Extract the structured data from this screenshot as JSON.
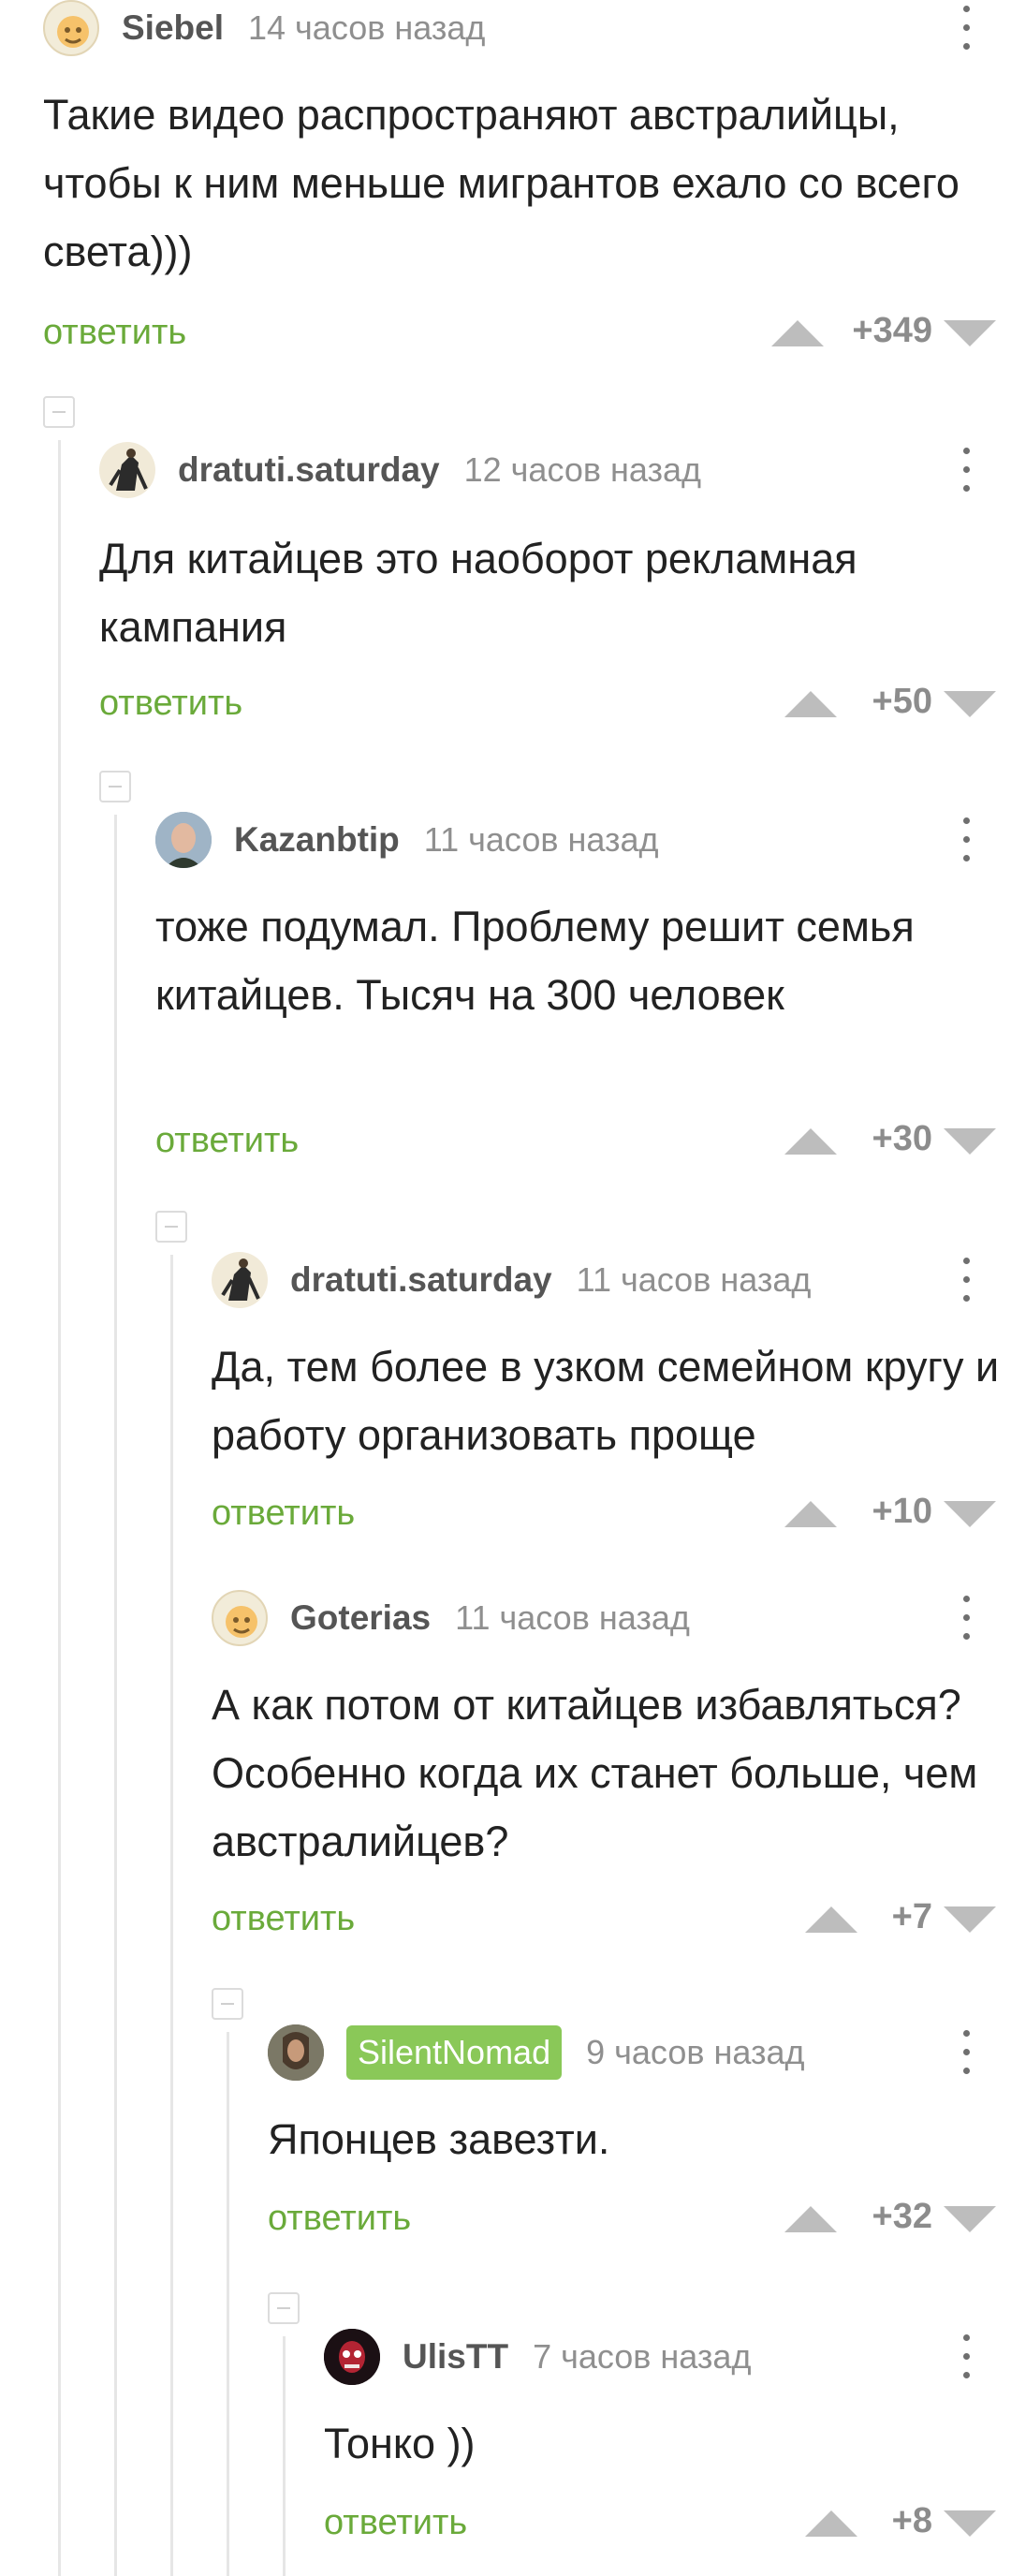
{
  "comments": [
    {
      "username": "Siebel",
      "time": "14 часов назад",
      "text": "Такие видео распространяют австралийцы, чтобы к ним меньше мигрантов ехало со всего света)))",
      "reply": "ответить",
      "rating": "+349"
    },
    {
      "username": "dratuti.saturday",
      "time": "12 часов назад",
      "text": "Для китайцев это наоборот рекламная кампания",
      "reply": "ответить",
      "rating": "+50"
    },
    {
      "username": "Kazanbtip",
      "time": "11 часов назад",
      "text": "тоже подумал. Проблему решит семья китайцев. Тысяч на 300 человек",
      "reply": "ответить",
      "rating": "+30"
    },
    {
      "username": "dratuti.saturday",
      "time": "11 часов назад",
      "text": "Да, тем более в узком семейном кругу и работу организовать проще",
      "reply": "ответить",
      "rating": "+10"
    },
    {
      "username": "Goterias",
      "time": "11 часов назад",
      "text": "А как потом от китайцев избавляться? Особенно когда их станет больше, чем австралийцев?",
      "reply": "ответить",
      "rating": "+7"
    },
    {
      "username": "SilentNomad",
      "time": "9 часов назад",
      "text": "Японцев завезти.",
      "reply": "ответить",
      "rating": "+32"
    },
    {
      "username": "UlisTT",
      "time": "7 часов назад",
      "text": "Тонко ))",
      "reply": "ответить",
      "rating": "+8"
    }
  ],
  "icons": {
    "more": "more-vertical-icon",
    "upvote": "upvote-arrow-icon",
    "downvote": "downvote-arrow-icon",
    "collapse": "collapse-thread-icon"
  },
  "colors": {
    "reply": "#6aaa3a",
    "badge": "#8ac858",
    "vote": "#bdbdbd"
  }
}
